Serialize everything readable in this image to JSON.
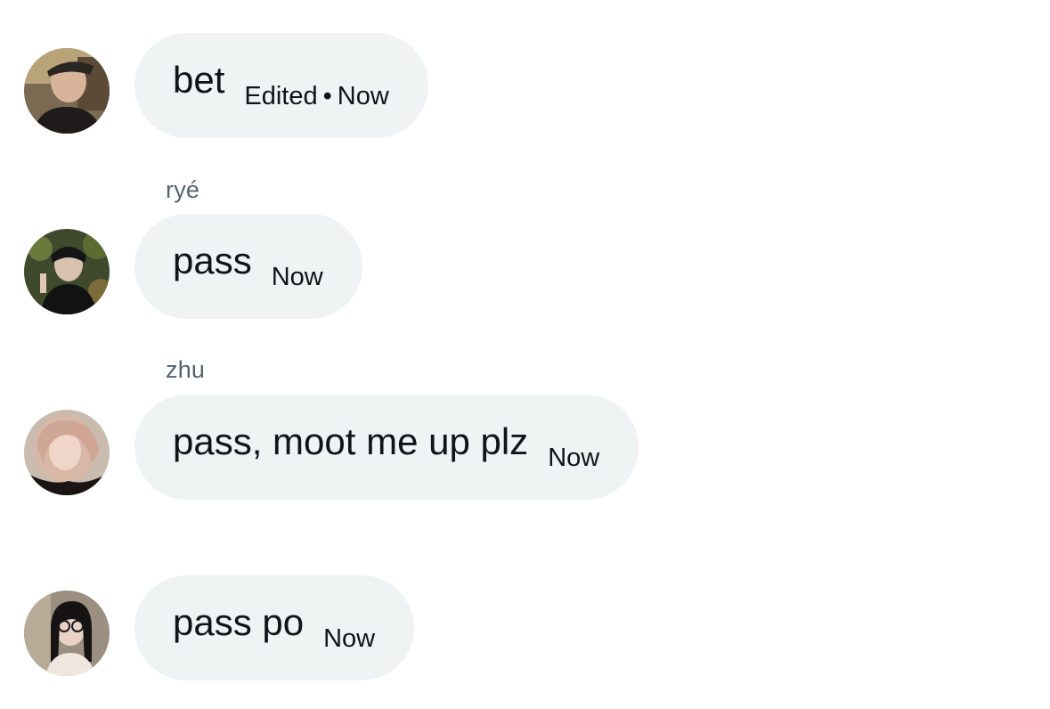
{
  "messages": [
    {
      "sender": "",
      "text": "bet",
      "edited_label": "Edited",
      "separator": "•",
      "time": "Now",
      "avatar_icon": "user-avatar-1"
    },
    {
      "sender": "ryé",
      "text": "pass",
      "time": "Now",
      "avatar_icon": "user-avatar-2"
    },
    {
      "sender": "zhu",
      "text": "pass, moot me up plz",
      "time": "Now",
      "avatar_icon": "user-avatar-3"
    },
    {
      "sender": "",
      "text": "pass po",
      "time": "Now",
      "avatar_icon": "user-avatar-4"
    }
  ],
  "colors": {
    "bubble_bg": "#eff3f4",
    "text": "#0f1419",
    "sender_text": "#536471",
    "background": "#ffffff"
  }
}
